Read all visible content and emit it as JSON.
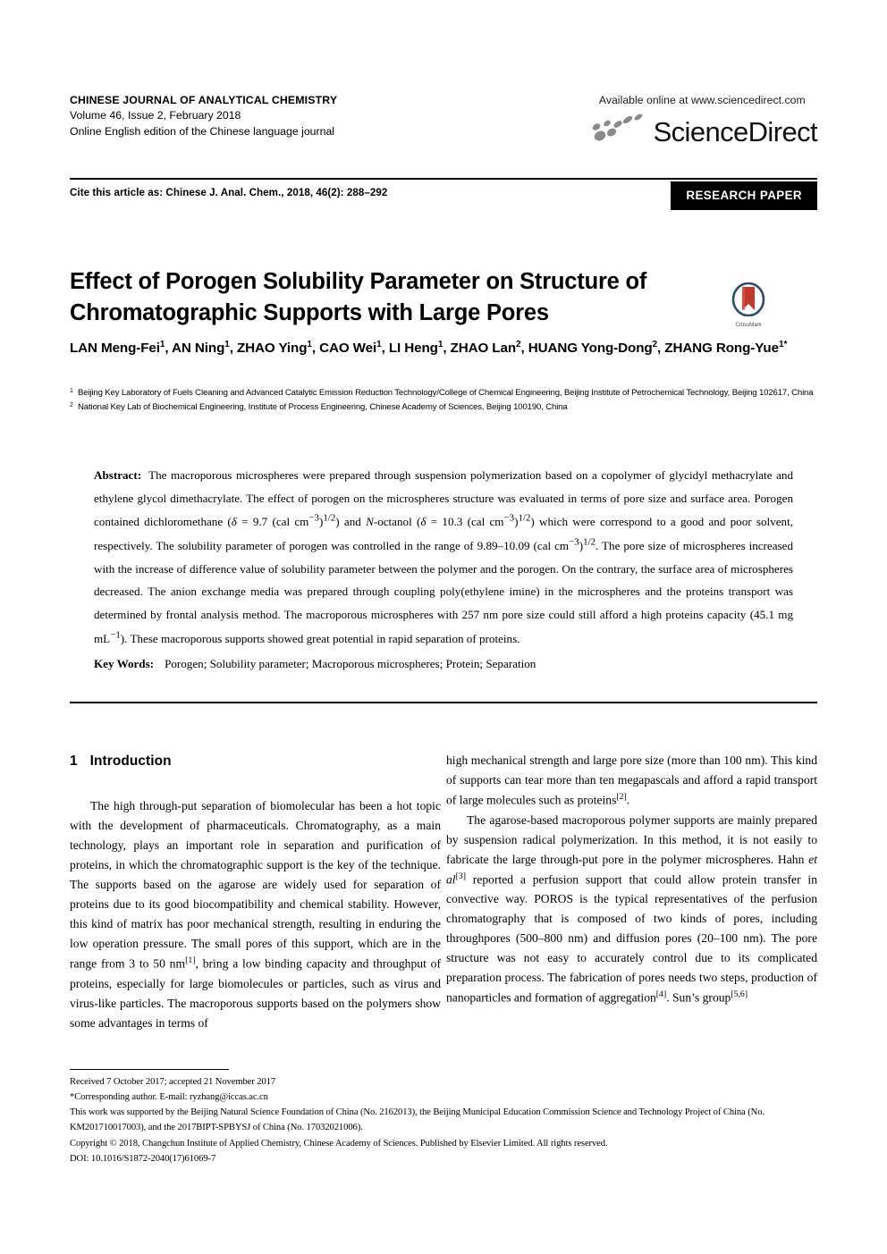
{
  "masthead": {
    "journal_name": "CHINESE JOURNAL OF ANALYTICAL CHEMISTRY",
    "volume_line": "Volume 46, Issue 2, February 2018",
    "edition_line": "Online English edition of the Chinese language journal",
    "available_online": "Available online at www.sciencedirect.com",
    "sciencedirect_wordmark": "ScienceDirect"
  },
  "citation": {
    "cite_text": "Cite this article as: Chinese J. Anal. Chem., 2018, 46(2): 288–292",
    "badge": "RESEARCH PAPER"
  },
  "article": {
    "title": "Effect of Porogen Solubility Parameter on Structure of Chromatographic Supports with Large Pores",
    "crossmark_label": "CrossMark",
    "authors_html": "LAN Meng-Fei<sup>1</sup>, AN Ning<sup>1</sup>, ZHAO Ying<sup>1</sup>, CAO Wei<sup>1</sup>, LI Heng<sup>1</sup>, ZHAO Lan<sup>2</sup>, HUANG Yong-Dong<sup>2</sup>, ZHANG Rong-Yue<sup>1*</sup>",
    "affiliations": [
      {
        "marker": "1",
        "text": "Beijing Key Laboratory of Fuels Cleaning and Advanced Catalytic Emission Reduction Technology/College of Chemical Engineering, Beijing Institute of Petrochemical Technology, Beijing 102617, China"
      },
      {
        "marker": "2",
        "text": "National Key Lab of Biochemical Engineering, Institute of Process Engineering, Chinese Academy of Sciences, Beijing 100190, China"
      }
    ]
  },
  "abstract": {
    "label": "Abstract:",
    "body_html": "The macroporous microspheres were prepared through suspension polymerization based on a copolymer of glycidyl methacrylate and ethylene glycol dimethacrylate. The effect of porogen on the microspheres structure was evaluated in terms of pore size and surface area. Porogen contained dichloromethane (<i>δ</i> = 9.7 (cal cm<sup>−3</sup>)<sup>1/2</sup>) and <i>N</i>-octanol (<i>δ</i> = 10.3 (cal cm<sup>−3</sup>)<sup>1/2</sup>) which were correspond to a good and poor solvent, respectively. The solubility parameter of porogen was controlled in the range of 9.89–10.09 (cal cm<sup>−3</sup>)<sup>1/2</sup>. The pore size of microspheres increased with the increase of difference value of solubility parameter between the polymer and the porogen. On the contrary, the surface area of microspheres decreased. The anion exchange media was prepared through coupling poly(ethylene imine) in the microspheres and the proteins transport was determined by frontal analysis method. The macroporous microspheres with 257 nm pore size could still afford a high proteins capacity (45.1 mg mL<sup>−1</sup>). These macroporous supports showed great potential in rapid separation of proteins."
  },
  "keywords": {
    "label": "Key Words:",
    "text": "Porogen; Solubility parameter; Macroporous microspheres; Protein; Separation"
  },
  "introduction": {
    "number": "1",
    "heading": "Introduction",
    "left_paragraph_html": "The high through-put separation of biomolecular has been a hot topic with the development of pharmaceuticals. Chromatography, as a main technology, plays an important role in separation and purification of proteins, in which the chromatographic support is the key of the technique. The supports based on the agarose are widely used for separation of proteins due to its good biocompatibility and chemical stability. However, this kind of matrix has poor mechanical strength, resulting in enduring the low operation pressure. The small pores of this support, which are in the range from 3 to 50 nm<sup>[1]</sup>, bring a low binding capacity and throughput of proteins, especially for large biomolecules or particles, such as virus and virus-like particles. The macroporous supports based on the polymers show some advantages in terms of",
    "right_paragraph_1_html": "high mechanical strength and large pore size (more than 100 nm). This kind of supports can tear more than ten megapascals and afford a rapid transport of large molecules such as proteins<sup>[2]</sup>.",
    "right_paragraph_2_html": "The agarose-based macroporous polymer supports are mainly prepared by suspension radical polymerization. In this method, it is not easily to fabricate the large through-put pore in the polymer microspheres. Hahn <i>et al</i><sup>[3]</sup> reported a perfusion support that could allow protein transfer in convective way. POROS is the typical representatives of the perfusion chromatography that is composed of two kinds of pores, including throughpores (500–800 nm) and diffusion pores (20–100 nm). The pore structure was not easy to accurately control due to its complicated preparation process. The fabrication of pores needs two steps, production of nanoparticles and formation of aggregation<sup>[4]</sup>. Sun’s group<sup>[5,6]</sup>"
  },
  "footnotes": {
    "received": "Received 7 October 2017; accepted 21 November 2017",
    "corresponding": "*Corresponding author. E-mail: ryzhang@iccas.ac.cn",
    "funding": "This work was supported by the Beijing Natural Science Foundation of China (No. 2162013), the Beijing Municipal Education Commission Science and Technology Project of China (No. KM201710017003), and the 2017BIPT-SPBYSJ of China (No. 17032021006).",
    "copyright": "Copyright © 2018, Changchun Institute of Applied Chemistry, Chinese Academy of Sciences. Published by Elsevier Limited. All rights reserved.",
    "doi": "DOI: 10.1016/S1872-2040(17)61069-7"
  },
  "colors": {
    "text": "#000000",
    "badge_bg": "#000000",
    "badge_text": "#ffffff",
    "crossmark_ring": "#2e4a6b",
    "crossmark_ribbon": "#c0392b",
    "sciencedirect_swoosh": "#808080"
  }
}
